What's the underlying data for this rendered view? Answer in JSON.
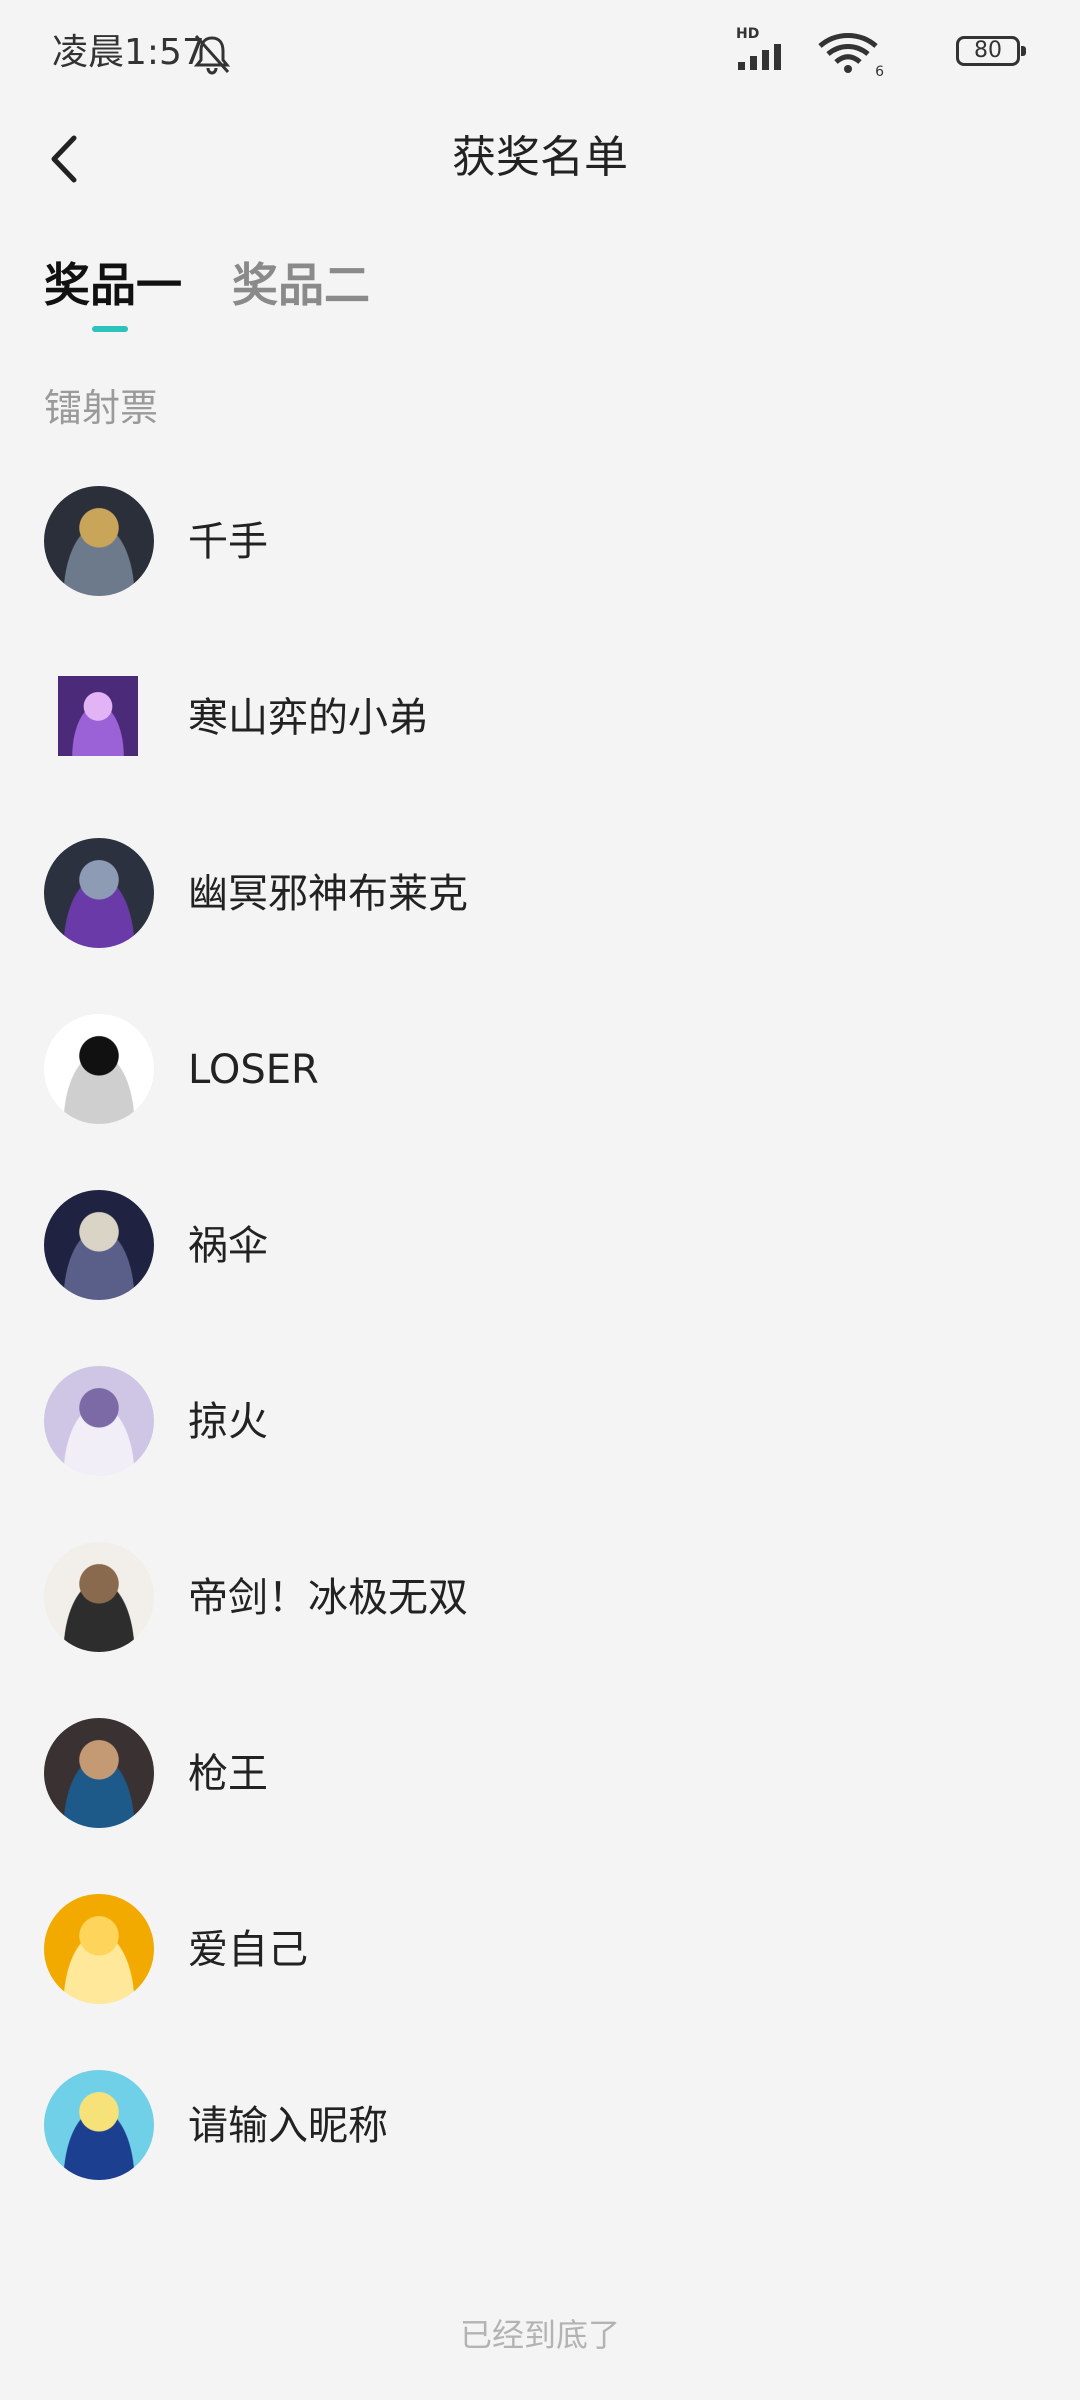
{
  "status_bar": {
    "time": "凌晨1:57",
    "network": "HD",
    "wifi_badge": "6",
    "battery": "80"
  },
  "header": {
    "title": "获奖名单",
    "back_icon": "chevron-left-icon"
  },
  "tabs": [
    {
      "label": "奖品一",
      "active": true
    },
    {
      "label": "奖品二",
      "active": false
    }
  ],
  "section_label": "镭射票",
  "winners": [
    {
      "name": "千手",
      "avatar_colors": [
        "#2a2f3a",
        "#c9a55a",
        "#6d7a8c"
      ]
    },
    {
      "name": "寒山弈的小弟",
      "avatar_colors": [
        "#4b2a7a",
        "#e3b4f5",
        "#9a62d6"
      ]
    },
    {
      "name": "幽冥邪神布莱克",
      "avatar_colors": [
        "#2c3140",
        "#8d9bb5",
        "#6a3aa8"
      ]
    },
    {
      "name": "LOSER",
      "avatar_colors": [
        "#ffffff",
        "#111111",
        "#cfcfcf"
      ]
    },
    {
      "name": "祸伞",
      "avatar_colors": [
        "#1f2240",
        "#d9d4c6",
        "#5a5f8a"
      ]
    },
    {
      "name": "掠火",
      "avatar_colors": [
        "#cfc6e6",
        "#7b6aa6",
        "#f2eef8"
      ]
    },
    {
      "name": "帝剑！冰极无双",
      "avatar_colors": [
        "#f2efea",
        "#8a6a4f",
        "#2d2d2d"
      ]
    },
    {
      "name": "枪王",
      "avatar_colors": [
        "#3a3232",
        "#c49a74",
        "#1d5a8a"
      ]
    },
    {
      "name": "爱自己",
      "avatar_colors": [
        "#f2a900",
        "#ffd45a",
        "#ffe89a"
      ]
    },
    {
      "name": "请输入昵称",
      "avatar_colors": [
        "#6fd0e8",
        "#f7e27a",
        "#1c3f8f"
      ]
    }
  ],
  "end_text": "已经到底了"
}
